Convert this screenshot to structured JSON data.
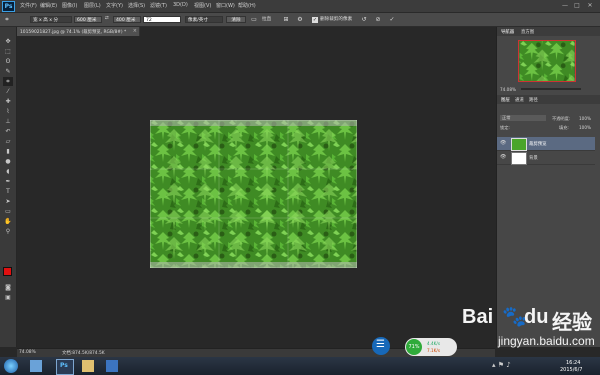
{
  "menubar": {
    "logo": "Ps",
    "items": [
      "文件(F)",
      "编辑(E)",
      "图像(I)",
      "图层(L)",
      "文字(Y)",
      "选择(S)",
      "滤镜(T)",
      "3D(D)",
      "视图(V)",
      "窗口(W)",
      "帮助(H)"
    ],
    "window_controls": {
      "minimize": "—",
      "maximize": "□",
      "close": "✕"
    }
  },
  "options": {
    "mode_select": "宽 x 高 x 分",
    "width_value": "600 厘米",
    "height_value": "400 厘米",
    "resolution_value": "72",
    "unit_select": "像素/英寸",
    "clear_button": "清除",
    "straighten_label": "拉直",
    "delete_cropped_label": "删除裁剪的像素"
  },
  "document": {
    "tab_title": "10159021827.jpg @ 74.1% (裁剪预览, RGB/8#) *",
    "close_icon": "×"
  },
  "statusbar": {
    "zoom": "74.08%",
    "doc_size": "文档:874.5K/874.5K"
  },
  "navigator": {
    "tabs": [
      "导航器",
      "直方图"
    ],
    "zoom": "74.08%"
  },
  "layers": {
    "tabs": [
      "图层",
      "通道",
      "路径"
    ],
    "blend_mode": "正常",
    "opacity_label": "不透明度:",
    "opacity_value": "100%",
    "lock_label": "锁定:",
    "fill_label": "填充:",
    "fill_value": "100%",
    "items": [
      {
        "name": "裁剪预览"
      },
      {
        "name": "背景"
      }
    ]
  },
  "taskbar": {
    "clock_time": "16:24",
    "clock_date": "2015/6/7",
    "net_percent": "71%",
    "net_up": "4.4K/s",
    "net_down": "7.1K/s"
  },
  "watermark": {
    "brand": "Bai",
    "brand2": "du",
    "cn": "经验",
    "url": "jingyan.baidu.com"
  },
  "colors": {
    "accent_blue": "#3aa0e6",
    "foreground": "#e01010",
    "background": "#ffffff",
    "crop_border": "#cc3333"
  }
}
